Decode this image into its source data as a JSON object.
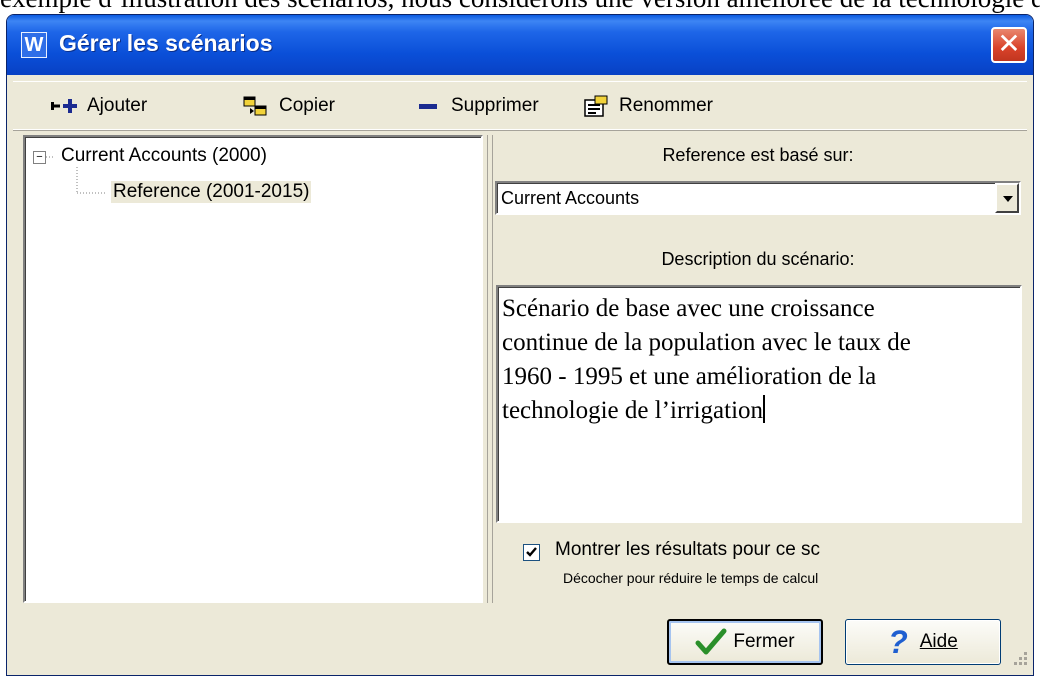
{
  "background_text": "exemple d’illustration des scénarios, nous considérons une version améliorée de la technologie de l’irrigation",
  "window": {
    "app_icon_letter": "W",
    "title": "Gérer les scénarios"
  },
  "toolbar": {
    "add_label": "Ajouter",
    "copy_label": "Copier",
    "delete_label": "Supprimer",
    "rename_label": "Renommer"
  },
  "tree": {
    "root": {
      "label": "Current Accounts (2000)",
      "expander": "−"
    },
    "child": {
      "label": "Reference (2001-2015)"
    }
  },
  "right": {
    "based_on_label": "Reference est basé sur:",
    "based_on_value": "Current Accounts",
    "description_label": "Description du scénario:",
    "description_lines": [
      "Scénario de base avec une croissance",
      "continue de la population avec le taux de",
      "1960 - 1995 et une amélioration de la",
      "technologie de l’irrigation"
    ],
    "show_results_label": "Montrer les résultats pour ce sc",
    "show_results_checked": true,
    "hint": "Décocher pour réduire le temps de calcul"
  },
  "footer": {
    "close_label": "Fermer",
    "help_label": "Aide",
    "help_glyph": "?"
  },
  "colors": {
    "titlebar": "#0a4fd8",
    "close_red": "#d9422a",
    "window_bg": "#ece9d8",
    "check_green": "#2a8f2a",
    "help_blue": "#1f5fd0"
  }
}
